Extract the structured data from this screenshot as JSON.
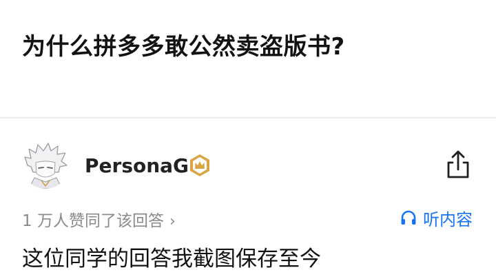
{
  "question": {
    "title": "为什么拼多多敢公然卖盗版书?"
  },
  "answer": {
    "author": {
      "name": "PersonaG",
      "avatar_icon": "anime-boy-avatar",
      "badge_icon": "crown-badge-icon"
    },
    "upvote_text": "1 万人赞同了该回答",
    "upvote_chevron": "›",
    "listen_label": "听内容",
    "content": "这位同学的回答我截图保存至今"
  },
  "colors": {
    "accent": "#1772f6",
    "badge_gold": "#d9a441",
    "muted_text": "#8a8a8a",
    "primary_text": "#121212"
  }
}
